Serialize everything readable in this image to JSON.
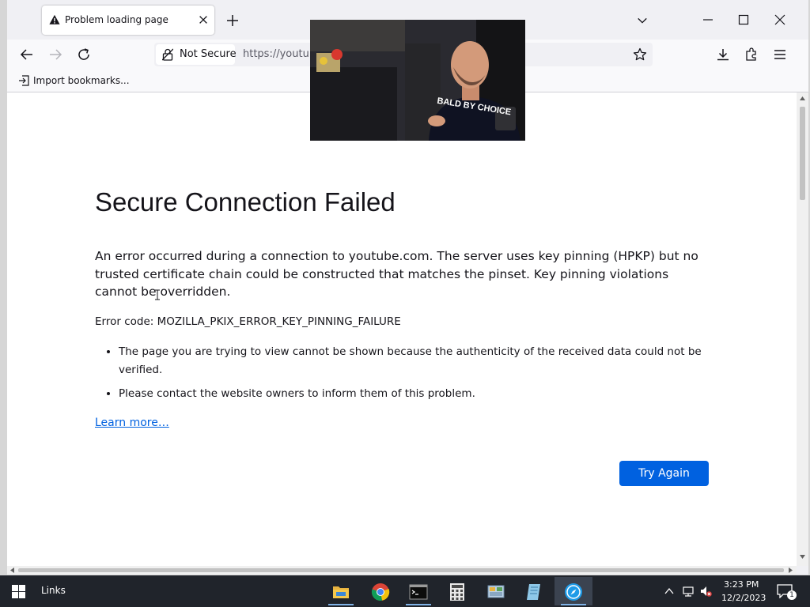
{
  "tab": {
    "title": "Problem loading page",
    "icon": "warning-icon"
  },
  "urlbar": {
    "security_label": "Not Secure",
    "url": "https://youtube.com"
  },
  "bookmarks": {
    "import_label": "Import bookmarks..."
  },
  "error": {
    "title": "Secure Connection Failed",
    "intro": "An error occurred during a connection to youtube.com. The server uses key pinning (HPKP) but no trusted certificate chain could be constructed that matches the pinset. Key pinning violations cannot be overridden.",
    "code": "Error code: MOZILLA_PKIX_ERROR_KEY_PINNING_FAILURE",
    "reasons": [
      "The page you are trying to view cannot be shown because the authenticity of the received data could not be verified.",
      "Please contact the website owners to inform them of this problem."
    ],
    "learn_more": "Learn more…",
    "try_again": "Try Again"
  },
  "pip": {
    "caption": "BALD BY CHOICE"
  },
  "taskbar": {
    "toolbar_label": "Links",
    "apps": [
      "file-explorer-icon",
      "chrome-icon",
      "terminal-icon",
      "calculator-icon",
      "control-panel-icon",
      "notepad-icon",
      "browser-icon"
    ],
    "clock": {
      "time": "3:23 PM",
      "date": "12/2/2023"
    },
    "notifications": "1"
  },
  "colors": {
    "accent": "#0061e0",
    "taskbar": "#20242b"
  }
}
